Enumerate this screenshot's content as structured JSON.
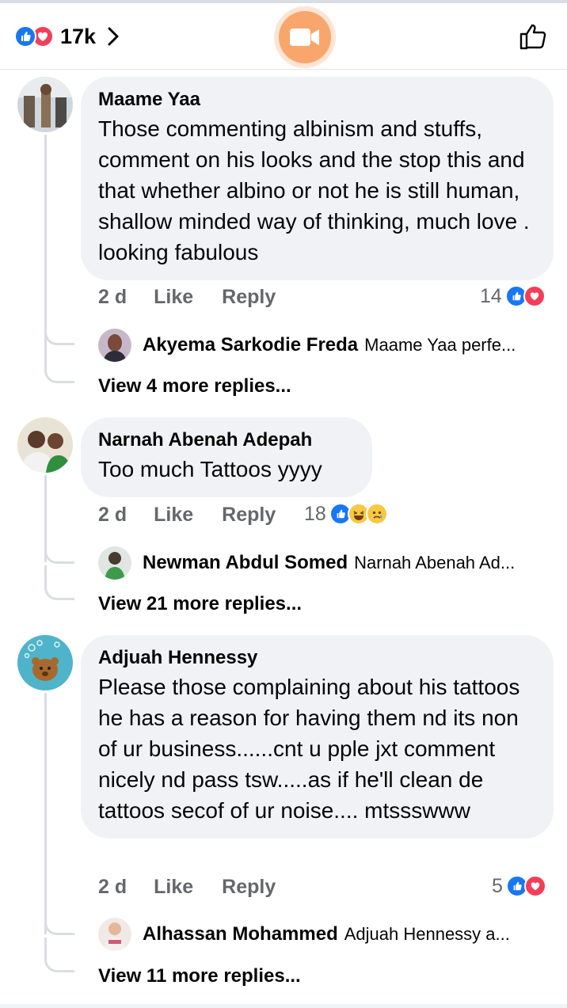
{
  "header": {
    "reaction_count": "17k",
    "icons": [
      "like-icon",
      "love-icon",
      "chevron-right-icon",
      "video-camera-icon",
      "thumbs-up-icon"
    ]
  },
  "colors": {
    "like_blue": "#1877f2",
    "love_red": "#f33e58",
    "bubble_bg": "#f0f2f5",
    "meta_gray": "#65676b",
    "video_orange": "#f9a66c"
  },
  "actions": {
    "like": "Like",
    "reply": "Reply"
  },
  "comments": [
    {
      "author": "Maame Yaa",
      "text": "Those commenting albinism and stuffs, comment on his looks and the stop this and that whether albino or not he is still human, shallow minded way of thinking, much love . looking fabulous",
      "time": "2 d",
      "reaction_count": "14",
      "reaction_types": [
        "like",
        "love"
      ],
      "reply_author": "Akyema Sarkodie Freda",
      "reply_text": "Maame Yaa perfe...",
      "view_more": "View 4 more replies..."
    },
    {
      "author": "Narnah Abenah Adepah",
      "text": "Too much Tattoos yyyy",
      "time": "2 d",
      "reaction_count": "18",
      "reaction_types": [
        "like",
        "haha",
        "sad"
      ],
      "reply_author": "Newman Abdul Somed",
      "reply_text": "Narnah Abenah Ad...",
      "view_more": "View 21 more replies..."
    },
    {
      "author": "Adjuah Hennessy",
      "text": "Please those complaining about his tattoos he has a reason for having them nd its non of ur business......cnt u pple jxt comment nicely nd pass tsw.....as if he'll clean de tattoos secof of ur noise.... mtssswww",
      "time": "2 d",
      "reaction_count": "5",
      "reaction_types": [
        "like",
        "love"
      ],
      "reply_author": "Alhassan Mohammed",
      "reply_text": "Adjuah Hennessy a...",
      "view_more": "View 11 more replies..."
    }
  ]
}
